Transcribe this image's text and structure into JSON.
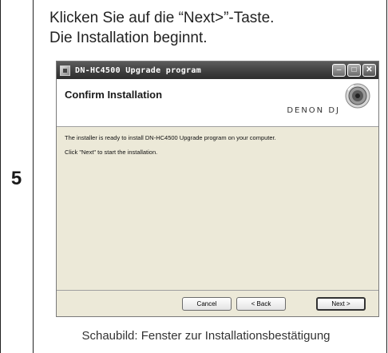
{
  "step": {
    "number": "5"
  },
  "instruction": {
    "line1": "Klicken Sie auf die “Next>”-Taste.",
    "line2": "Die Installation beginnt."
  },
  "window": {
    "title": "DN-HC4500 Upgrade program",
    "header_title": "Confirm Installation",
    "brand": "DENON DJ",
    "body_line1": "The installer is ready to install DN-HC4500 Upgrade program on your computer.",
    "body_line2": "Click \"Next\" to start the installation.",
    "buttons": {
      "cancel": "Cancel",
      "back": "< Back",
      "next": "Next >"
    },
    "icons": {
      "app": "installer-icon",
      "minimize": "minimize-icon",
      "maximize": "maximize-icon",
      "close": "close-icon",
      "logo": "denon-dj-logo-icon"
    }
  },
  "caption": "Schaubild: Fenster zur Installationsbestätigung"
}
